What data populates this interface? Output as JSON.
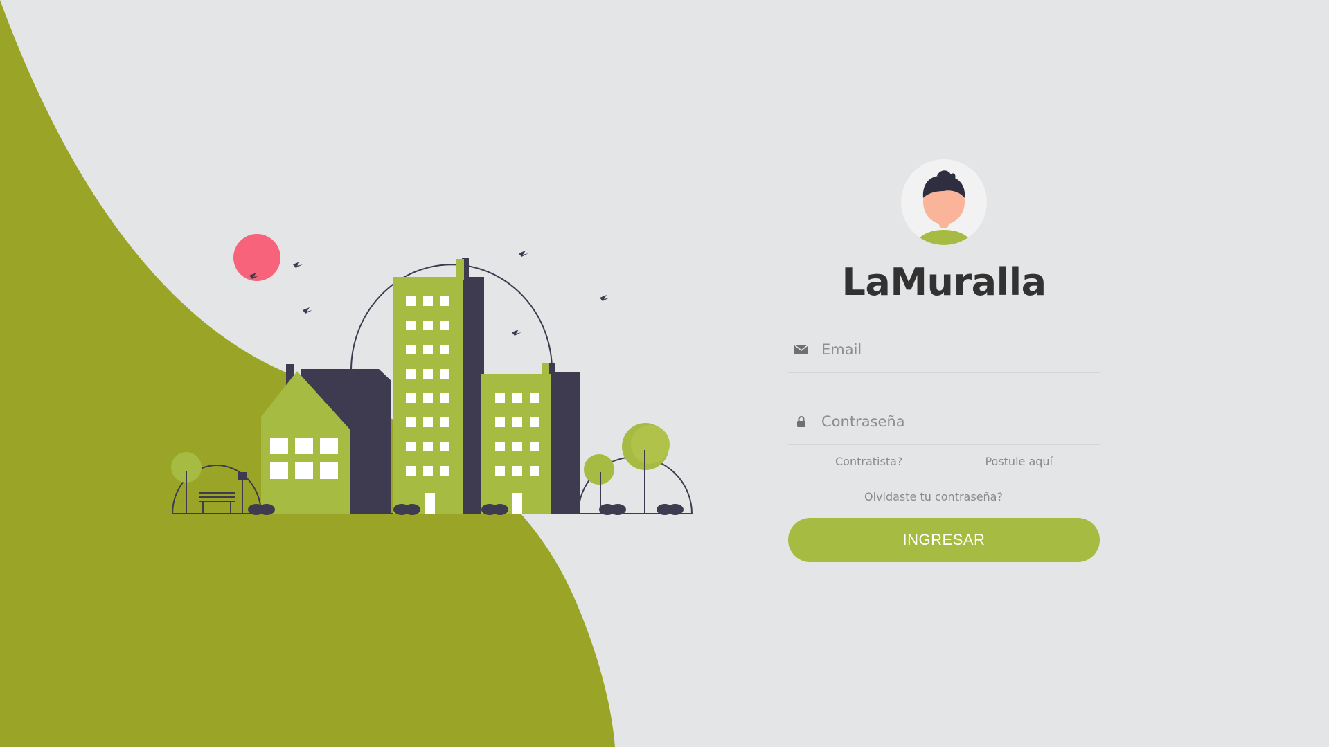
{
  "brand": {
    "title": "LaMuralla",
    "accent_color": "#a6bb41",
    "background_color": "#e4e5e7",
    "wave_color": "#9aa527"
  },
  "login": {
    "email": {
      "icon": "envelope-icon",
      "placeholder": "Email",
      "value": ""
    },
    "password": {
      "icon": "lock-icon",
      "placeholder": "Contraseña",
      "value": ""
    },
    "links": {
      "contractor": "Contratista?",
      "apply": "Postule aquí",
      "forgot": "Olvidaste tu contraseña?"
    },
    "submit_label": "INGRESAR"
  },
  "illustration": {
    "icon": "city-buildings-illustration",
    "sun_color": "#f7637a",
    "dark_color": "#3e3b50"
  }
}
